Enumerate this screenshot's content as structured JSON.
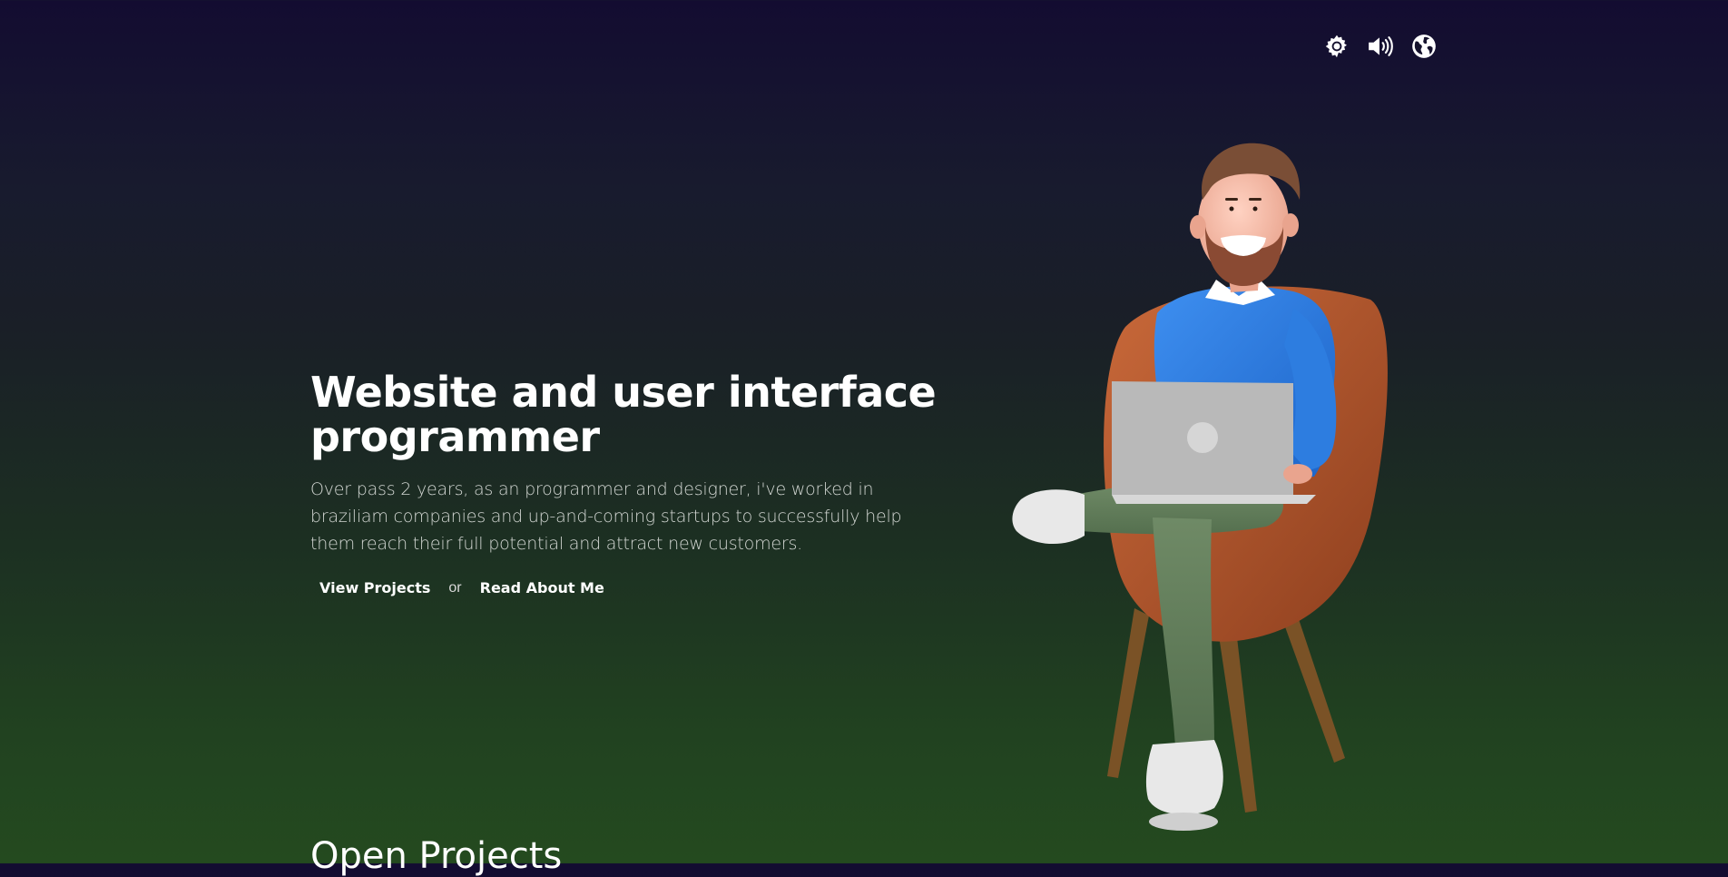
{
  "toolbar": {
    "icons": [
      "theme-gear-icon",
      "volume-icon",
      "globe-icon"
    ]
  },
  "hero": {
    "title": "Website and user interface programmer",
    "description": "Over pass 2 years, as an programmer and designer, i've worked in braziliam companies and up-and-coming startups to successfully help them reach their full potential and attract new customers.",
    "primary_link": "View Projects",
    "separator": "or",
    "secondary_link": "Read About Me"
  },
  "sections": {
    "open_projects_title": "Open Projects"
  },
  "colors": {
    "bg_top": "#130c31",
    "bg_bottom": "#244a1f",
    "text": "#ffffff",
    "muted_text": "#d3d7d3"
  }
}
